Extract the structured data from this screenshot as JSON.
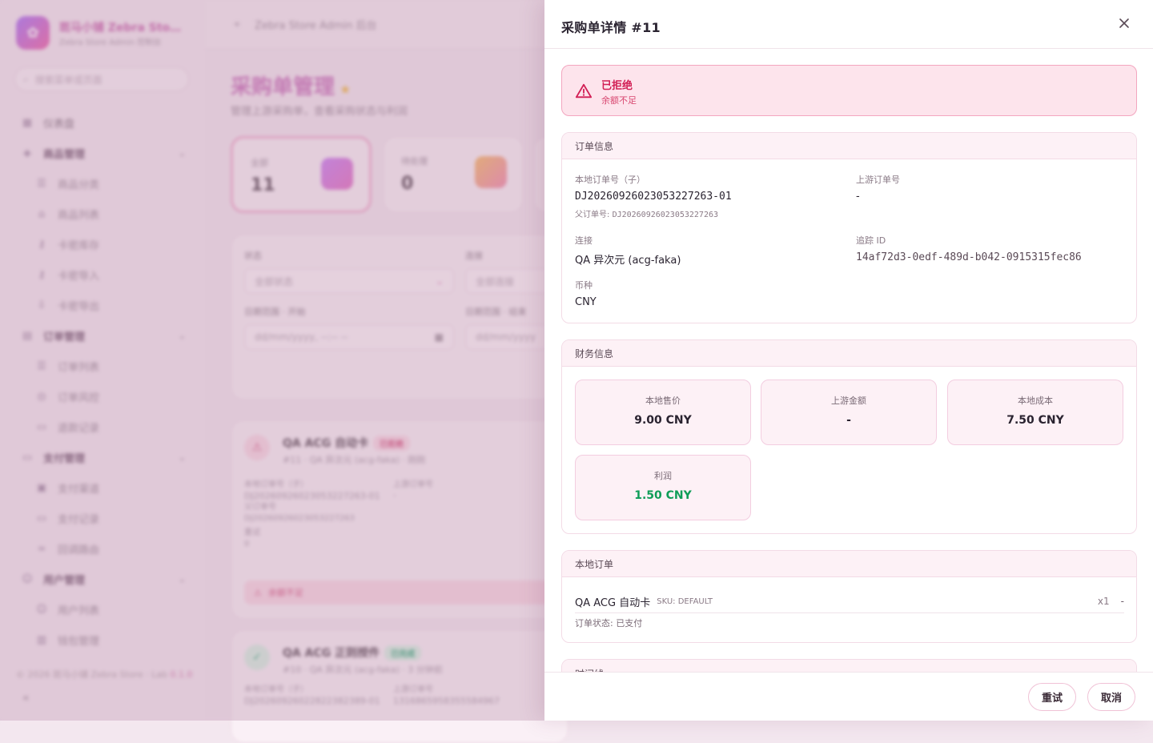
{
  "background": {
    "brand_name": "斑马小铺 Zebra Sto…",
    "brand_sub": "Zebra Store Admin 控制台",
    "search_placeholder": "搜索菜单或页面",
    "sidebar": [
      {
        "label": "仪表盘",
        "type": "item",
        "icon": "dashboard-icon"
      },
      {
        "label": "商品管理",
        "type": "group",
        "icon": "box-icon"
      },
      {
        "label": "商品分类",
        "type": "sub",
        "icon": "list-icon"
      },
      {
        "label": "商品列表",
        "type": "sub",
        "icon": "shop-icon"
      },
      {
        "label": "卡密库存",
        "type": "sub",
        "icon": "key-icon"
      },
      {
        "label": "卡密导入",
        "type": "sub",
        "icon": "key-icon"
      },
      {
        "label": "卡密导出",
        "type": "sub",
        "icon": "export-icon"
      },
      {
        "label": "订单管理",
        "type": "group",
        "icon": "order-icon"
      },
      {
        "label": "订单列表",
        "type": "sub",
        "icon": "list-icon"
      },
      {
        "label": "订单风控",
        "type": "sub",
        "icon": "shield-icon"
      },
      {
        "label": "退款记录",
        "type": "sub",
        "icon": "doc-icon"
      },
      {
        "label": "支付管理",
        "type": "group",
        "icon": "card-icon"
      },
      {
        "label": "支付渠道",
        "type": "sub",
        "icon": "channel-icon"
      },
      {
        "label": "支付记录",
        "type": "sub",
        "icon": "doc-icon"
      },
      {
        "label": "回调路由",
        "type": "sub",
        "icon": "link-icon"
      },
      {
        "label": "用户管理",
        "type": "group",
        "icon": "user-icon"
      },
      {
        "label": "用户列表",
        "type": "sub",
        "icon": "user-icon"
      },
      {
        "label": "钱包管理",
        "type": "sub",
        "icon": "wallet-icon"
      }
    ],
    "footer": "© 2026 斑马小铺 Zebra Store · Lab",
    "version": "0.1.0",
    "breadcrumb": "Zebra Store Admin 后台",
    "page_title": "采购单管理",
    "page_desc": "管理上游采购单，查看采购状态与利润",
    "stats": [
      {
        "label": "全部",
        "value": "11"
      },
      {
        "label": "待处理",
        "value": "0"
      }
    ],
    "filters": {
      "status_label": "状态",
      "status_value": "全部状态",
      "connection_label": "连接",
      "connection_value": "全部连接",
      "date_start_label": "日期范围 · 开始",
      "date_start_placeholder": "dd/mm/yyyy, --:-- --",
      "date_end_label": "日期范围 · 结束",
      "date_end_placeholder": "dd/mm/yyyy"
    },
    "orders": [
      {
        "title": "QA ACG 自动卡",
        "badge": "已拒绝",
        "meta": "#11 · QA 异次元 (acg-faka) · 刚刚",
        "local_label": "本地订单号（子）",
        "local_no": "DJ20260926023053227263-01",
        "parent_label": "父订单号",
        "parent_no": "DJ20260926023053227263",
        "upstream_label": "上游订单号",
        "upstream_no": "-",
        "extra_label": "重试",
        "extra_value": "0",
        "alert": "余额不足"
      },
      {
        "title": "QA ACG 正则授件",
        "badge": "已完成",
        "meta": "#10 · QA 异次元 (acg-faka) · 3 分钟前",
        "local_label": "本地订单号（子）",
        "local_no": "DJ20260926022822382389-01",
        "upstream_label": "上游订单号",
        "upstream_no": "1316865958355584967"
      }
    ]
  },
  "drawer": {
    "title": "采购单详情 #11",
    "alert": {
      "title": "已拒绝",
      "message": "余额不足",
      "color": "#d21f55"
    },
    "order_info": {
      "heading": "订单信息",
      "local_order_label": "本地订单号（子）",
      "local_order_value": "DJ20260926023053227263-01",
      "parent_label": "父订单号:",
      "parent_value": "DJ20260926023053227263",
      "upstream_order_label": "上游订单号",
      "upstream_order_value": "-",
      "connection_label": "连接",
      "connection_value": "QA 异次元 (acg-faka)",
      "trace_label": "追踪 ID",
      "trace_value": "14af72d3-0edf-489d-b042-0915315fec86",
      "currency_label": "币种",
      "currency_value": "CNY"
    },
    "finance": {
      "heading": "财务信息",
      "cards": [
        {
          "label": "本地售价",
          "value": "9.00 CNY"
        },
        {
          "label": "上游金额",
          "value": "-"
        },
        {
          "label": "本地成本",
          "value": "7.50 CNY"
        },
        {
          "label": "利润",
          "value": "1.50 CNY"
        }
      ],
      "profit_color": "#0f9d58"
    },
    "local_order": {
      "heading": "本地订单",
      "item_name": "QA ACG 自动卡",
      "item_sku": "SKU: DEFAULT",
      "item_qty": "x1",
      "item_price": "-",
      "status": "订单状态: 已支付"
    },
    "timeline_heading": "时间线",
    "buttons": {
      "retry": "重试",
      "cancel": "取消"
    }
  }
}
